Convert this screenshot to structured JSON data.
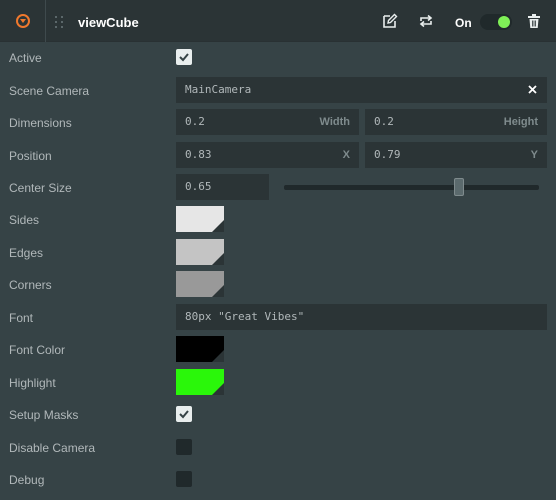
{
  "header": {
    "title": "viewCube",
    "on_label": "On",
    "enabled": true,
    "accent_color": "#f0782d",
    "toggle_color": "#7ff057"
  },
  "rows": {
    "active": {
      "label": "Active",
      "checked": true
    },
    "scene_camera": {
      "label": "Scene Camera",
      "value": "MainCamera"
    },
    "dimensions": {
      "label": "Dimensions",
      "width_value": "0.2",
      "width_unit": "Width",
      "height_value": "0.2",
      "height_unit": "Height"
    },
    "position": {
      "label": "Position",
      "x_value": "0.83",
      "x_unit": "X",
      "y_value": "0.79",
      "y_unit": "Y"
    },
    "center_size": {
      "label": "Center Size",
      "value": "0.65",
      "slider_fraction": 0.68
    },
    "sides": {
      "label": "Sides",
      "color": "#e6e6e6"
    },
    "edges": {
      "label": "Edges",
      "color": "#c4c4c4"
    },
    "corners": {
      "label": "Corners",
      "color": "#999999"
    },
    "font": {
      "label": "Font",
      "value": "80px \"Great Vibes\""
    },
    "font_color": {
      "label": "Font Color",
      "color": "#000000"
    },
    "highlight": {
      "label": "Highlight",
      "color": "#2af70a"
    },
    "setup_masks": {
      "label": "Setup Masks",
      "checked": true
    },
    "disable_camera": {
      "label": "Disable Camera",
      "checked": false
    },
    "debug": {
      "label": "Debug",
      "checked": false
    }
  },
  "icons": {
    "collapse": "collapse-arrow-icon",
    "drag": "drag-handle-icon",
    "edit": "edit-icon",
    "swap": "swap-icon",
    "delete": "trash-icon",
    "clear": "close-icon",
    "check": "checkmark-icon"
  }
}
